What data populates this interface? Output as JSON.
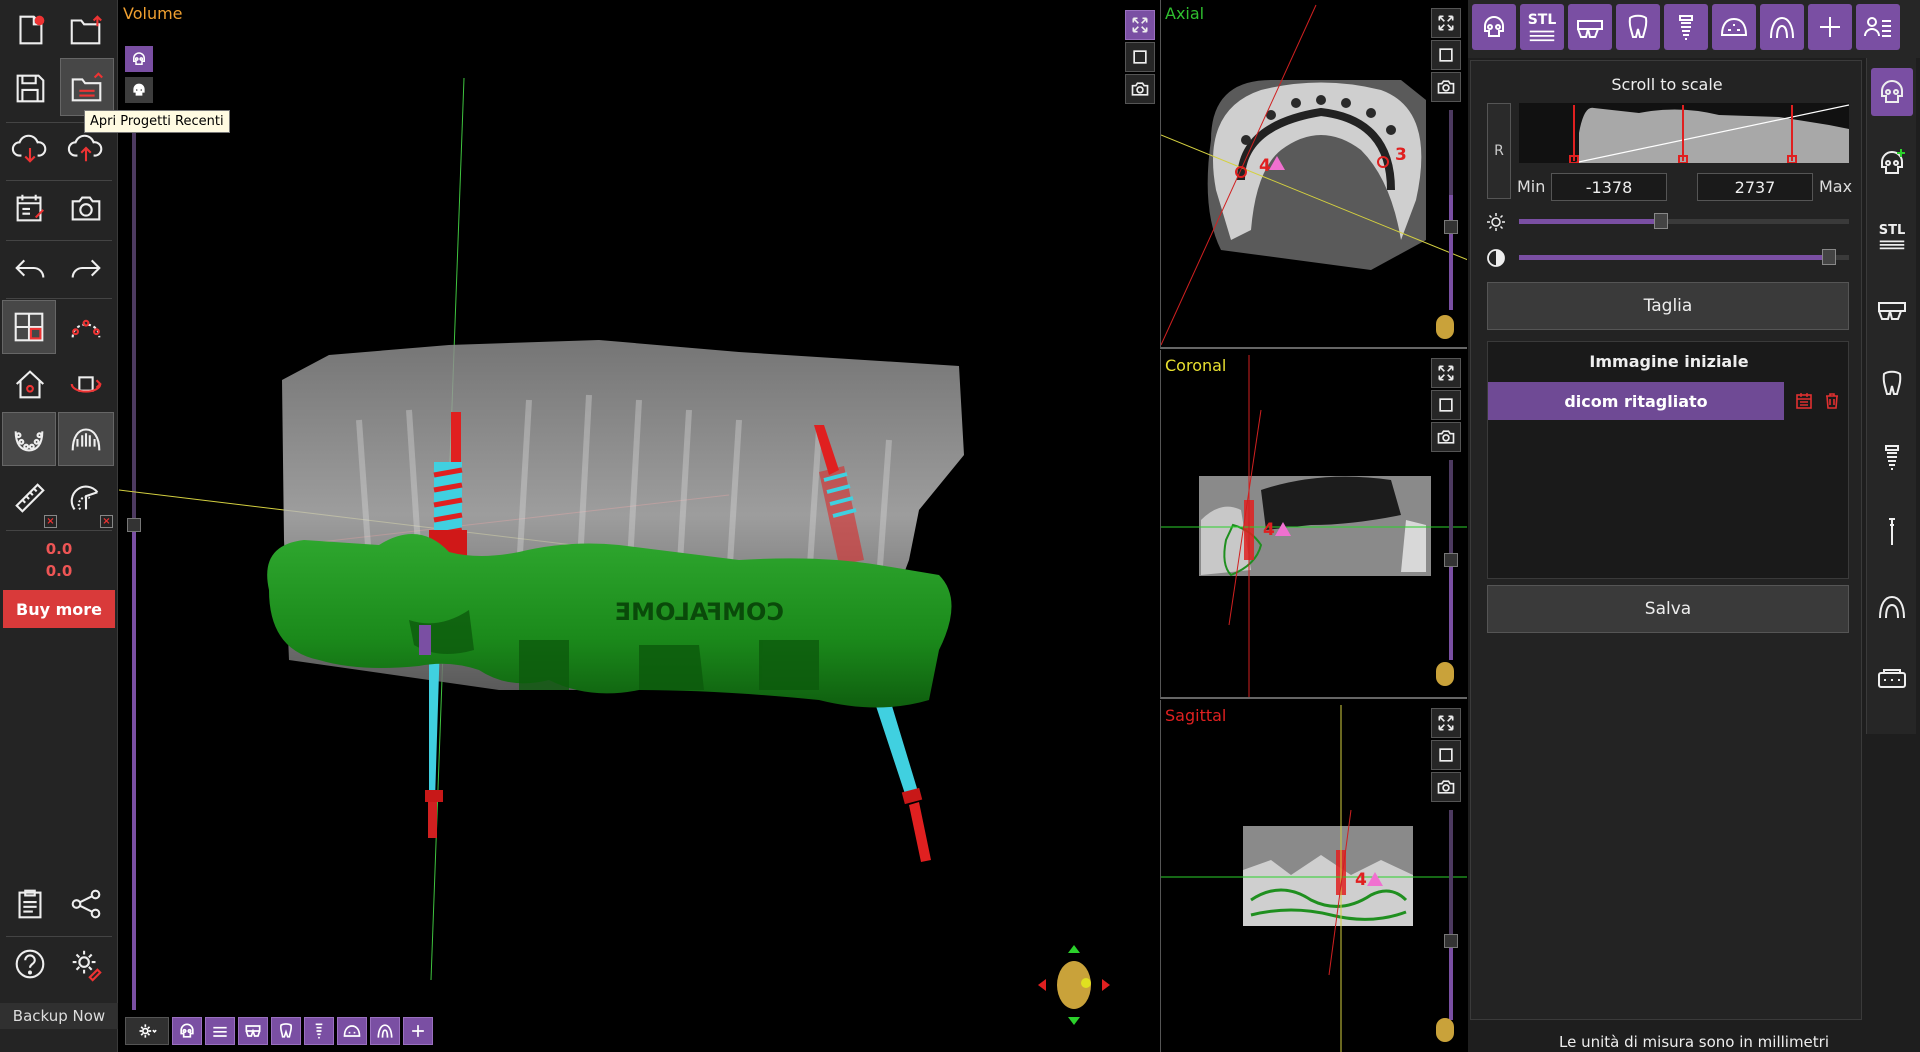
{
  "left_toolbar": {
    "tooltip": "Apri Progetti Recenti",
    "readout_1": "0.0",
    "readout_2": "0.0",
    "buy_more_label": "Buy more",
    "backup_label": "Backup Now"
  },
  "volume_view": {
    "title": "Volume",
    "title_color": "#f0a030",
    "guide_engraving": "COMFALOME"
  },
  "slice_views": {
    "axial": {
      "title": "Axial",
      "title_color": "#2fbf2f",
      "implant_a": "4",
      "implant_b": "3"
    },
    "coronal": {
      "title": "Coronal",
      "title_color": "#e8e030",
      "implant_a": "4"
    },
    "sagittal": {
      "title": "Sagittal",
      "title_color": "#e02020",
      "implant_a": "4"
    }
  },
  "top_tabs": {
    "stl_label": "STL"
  },
  "side_tabs": {
    "stl_label": "STL"
  },
  "panel": {
    "scale_title": "Scroll to scale",
    "r_label": "R",
    "min_label": "Min",
    "max_label": "Max",
    "min_value": "-1378",
    "max_value": "2737",
    "brightness_level": 0.43,
    "contrast_level": 0.94,
    "cut_label": "Taglia",
    "images_title": "Immagine iniziale",
    "image_item": "dicom ritagliato",
    "save_label": "Salva",
    "units_note": "Le unità di misura sono in millimetri"
  },
  "colors": {
    "accent": "#7a4fa3",
    "danger": "#d93a3a",
    "guide": "#1f8f1f",
    "implant_body": "#40d0e0",
    "implant_head": "#e02020"
  }
}
